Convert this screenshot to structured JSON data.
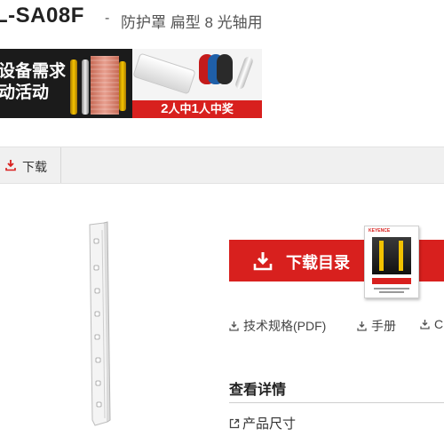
{
  "product": {
    "model": "L-SA08F",
    "separator": "-",
    "description": "防护罩 扁型 8 光轴用"
  },
  "banner": {
    "line1": "设备需求",
    "line2": "动活动",
    "prize_prefix": "",
    "prize_text_1": "2",
    "prize_text_2": "人中",
    "prize_text_3": "1",
    "prize_text_4": "人中奖"
  },
  "tabs": [
    {
      "label": "下载",
      "icon": "download-icon"
    }
  ],
  "catalog": {
    "button_label": "下载目录",
    "cover_brand": "KEYENCE"
  },
  "doc_links": {
    "spec": "技术规格(PDF)",
    "manual": "手册",
    "more": "C"
  },
  "details": {
    "heading": "查看详情",
    "link": "产品尺寸"
  },
  "colors": {
    "accent_red": "#d8201e",
    "tab_bar": "#f0f0f0",
    "banner_dark": "#1b1b1b"
  }
}
